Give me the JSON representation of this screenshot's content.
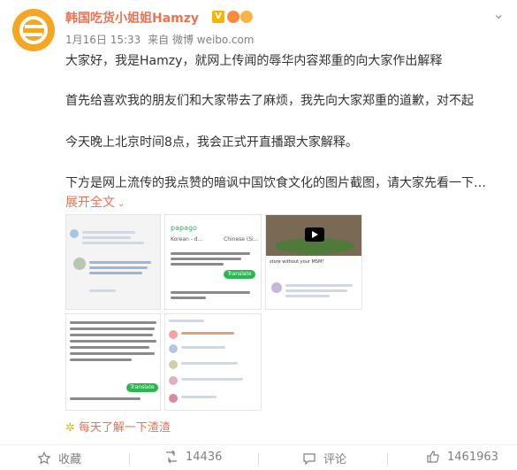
{
  "post": {
    "username": "韩国吃货小姐姐Hamzy",
    "time": "1月16日 15:33",
    "source": "来自 微博 weibo.com",
    "paragraphs": [
      "大家好，我是Hamzy，就网上传闻的辱华内容郑重的向大家作出解释",
      "首先给喜欢我的朋友们和大家带去了麻烦，我先向大家郑重的道歉，对不起",
      "今天晚上北京时间8点，我会正式开直播跟大家解释。",
      "下方是网上流传的我点赞的暗讽中国饮食文化的图片截图，请大家先看一下…"
    ],
    "expand_label": "展开全文",
    "topic": "每天了解一下渣渣"
  },
  "thumbs": {
    "t2_app": "papago",
    "t2_lang_from": "Korean - d...",
    "t2_lang_to": "Chinese (Si...",
    "t2_translate": "Translate",
    "t4_translate": "Translate",
    "t3_caption": "store without your MSM!"
  },
  "actions": {
    "favorite": "收藏",
    "repost_count": "14436",
    "comment": "评论",
    "like_count": "1461963"
  },
  "colors": {
    "accent": "#eb7350",
    "gold": "#f8b500",
    "text": "#333333",
    "muted": "#808080"
  }
}
